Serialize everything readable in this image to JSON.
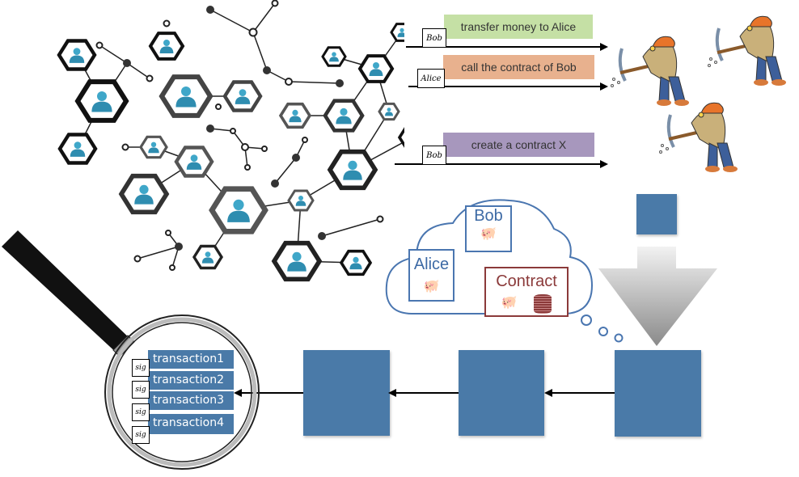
{
  "transactions_in": [
    {
      "sender": "Bob",
      "label": "transfer money to Alice",
      "color": "#c5e0a5"
    },
    {
      "sender": "Alice",
      "label": "call the contract of Bob",
      "color": "#e8b18e"
    },
    {
      "sender": "Bob",
      "label": "create a contract X",
      "color": "#a797bd"
    }
  ],
  "state_cloud": {
    "accounts": [
      {
        "name": "Bob",
        "icon": "piggy-bank-icon"
      },
      {
        "name": "Alice",
        "icon": "piggy-bank-icon"
      },
      {
        "name": "Contract",
        "icon": "piggy-bank-icon",
        "extra_icon": "coin-stack-icon"
      }
    ]
  },
  "miners": {
    "count": 3,
    "icon": "miner-icon"
  },
  "block_contents": {
    "transactions": [
      {
        "label": "transaction1",
        "sig": "sig"
      },
      {
        "label": "transaction2",
        "sig": "sig"
      },
      {
        "label": "transaction3",
        "sig": "sig"
      },
      {
        "label": "transaction4",
        "sig": "sig"
      }
    ]
  },
  "colors": {
    "block": "#4a7aa8",
    "cloud": "#4a76b0",
    "contract": "#8b3a3a"
  }
}
